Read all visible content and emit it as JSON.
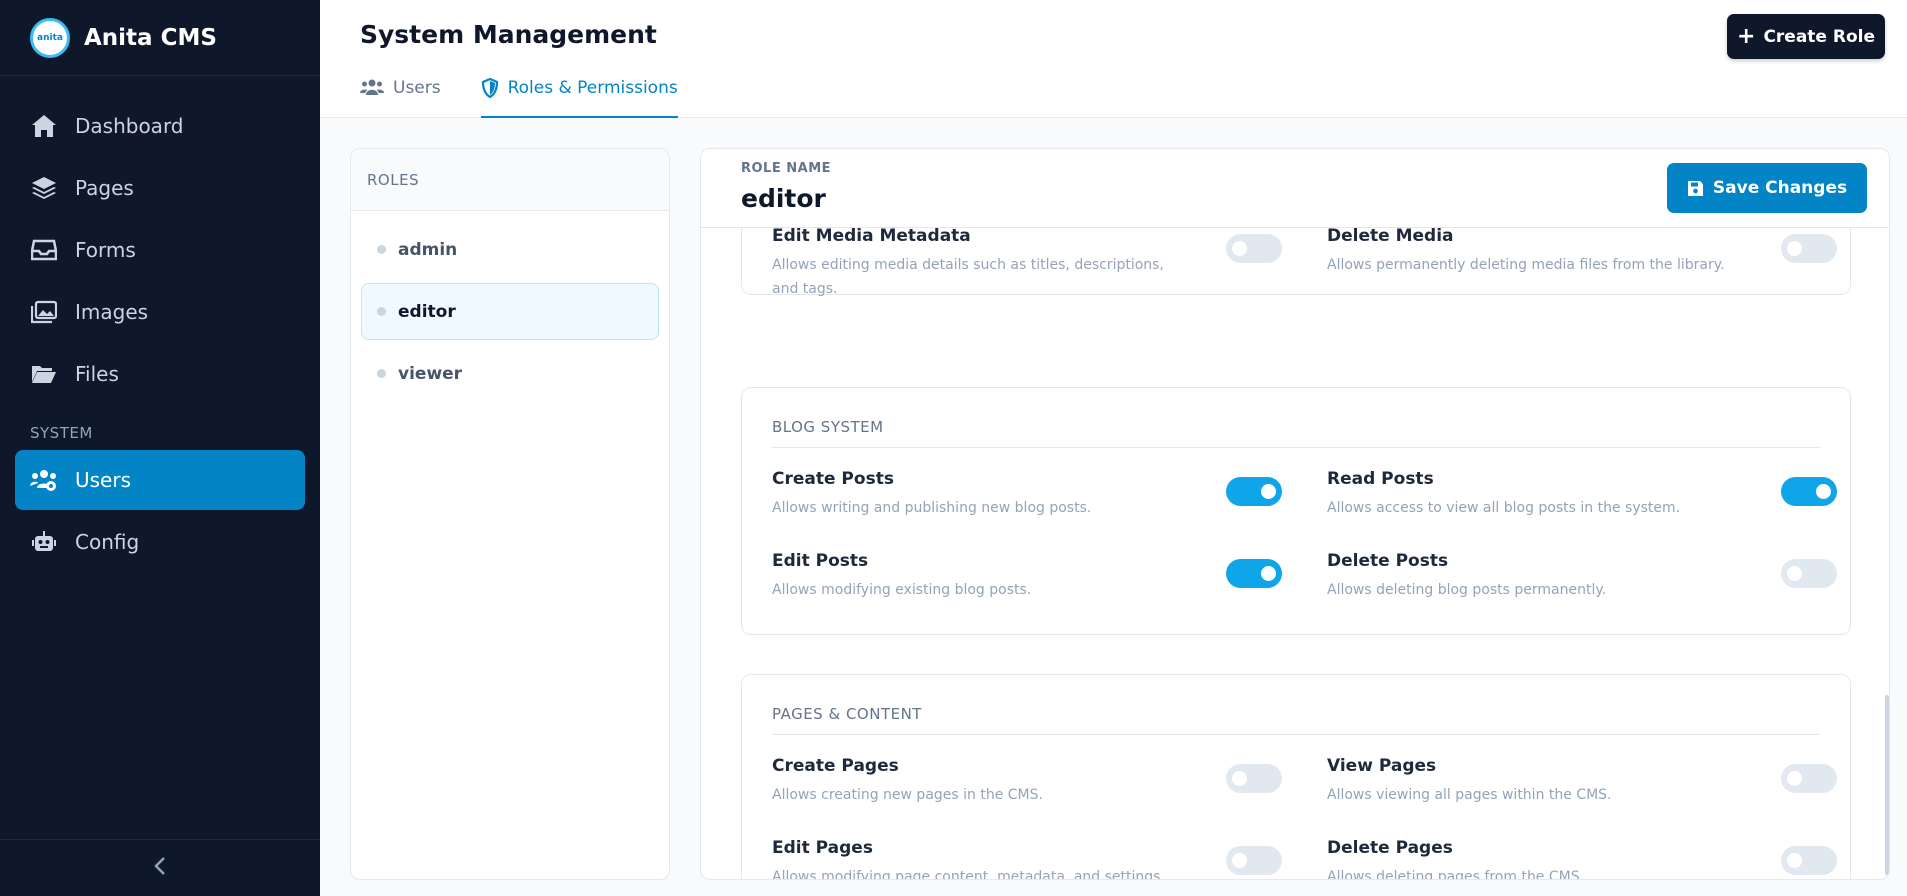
{
  "app": {
    "name": "Anita CMS",
    "logo_text": "anita"
  },
  "sidebar": {
    "items": [
      {
        "label": "Dashboard",
        "icon": "home-icon"
      },
      {
        "label": "Pages",
        "icon": "layers-icon"
      },
      {
        "label": "Forms",
        "icon": "inbox-icon"
      },
      {
        "label": "Images",
        "icon": "images-icon"
      },
      {
        "label": "Files",
        "icon": "folder-open-icon"
      }
    ],
    "section_label": "SYSTEM",
    "system_items": [
      {
        "label": "Users",
        "icon": "users-gear-icon",
        "active": true
      },
      {
        "label": "Config",
        "icon": "robot-icon"
      }
    ],
    "collapse_icon": "chevron-left-icon"
  },
  "header": {
    "title": "System Management",
    "create_button": "Create Role",
    "tabs": [
      {
        "label": "Users",
        "icon": "users-icon",
        "active": false
      },
      {
        "label": "Roles & Permissions",
        "icon": "shield-icon",
        "active": true
      }
    ]
  },
  "roles_panel": {
    "heading": "ROLES",
    "roles": [
      {
        "label": "admin",
        "active": false
      },
      {
        "label": "editor",
        "active": true
      },
      {
        "label": "viewer",
        "active": false
      }
    ]
  },
  "editor": {
    "role_name_label": "ROLE NAME",
    "role_name": "editor",
    "save_button": "Save Changes",
    "media_partial": {
      "permissions": [
        {
          "name": "Edit Media Metadata",
          "desc": "Allows editing media details such as titles, descriptions, and tags.",
          "enabled": false
        },
        {
          "name": "Delete Media",
          "desc": "Allows permanently deleting media files from the library.",
          "enabled": false
        }
      ]
    },
    "blog_system": {
      "title": "BLOG SYSTEM",
      "permissions": [
        {
          "name": "Create Posts",
          "desc": "Allows writing and publishing new blog posts.",
          "enabled": true
        },
        {
          "name": "Read Posts",
          "desc": "Allows access to view all blog posts in the system.",
          "enabled": true
        },
        {
          "name": "Edit Posts",
          "desc": "Allows modifying existing blog posts.",
          "enabled": true
        },
        {
          "name": "Delete Posts",
          "desc": "Allows deleting blog posts permanently.",
          "enabled": false
        }
      ]
    },
    "pages_content": {
      "title": "PAGES & CONTENT",
      "permissions": [
        {
          "name": "Create Pages",
          "desc": "Allows creating new pages in the CMS.",
          "enabled": false
        },
        {
          "name": "View Pages",
          "desc": "Allows viewing all pages within the CMS.",
          "enabled": false
        },
        {
          "name": "Edit Pages",
          "desc": "Allows modifying page content, metadata, and settings.",
          "enabled": false
        },
        {
          "name": "Delete Pages",
          "desc": "Allows deleting pages from the CMS.",
          "enabled": false
        }
      ]
    }
  },
  "colors": {
    "sidebar_bg": "#0f172a",
    "accent": "#0284c7",
    "toggle_on": "#0ea5e9"
  }
}
